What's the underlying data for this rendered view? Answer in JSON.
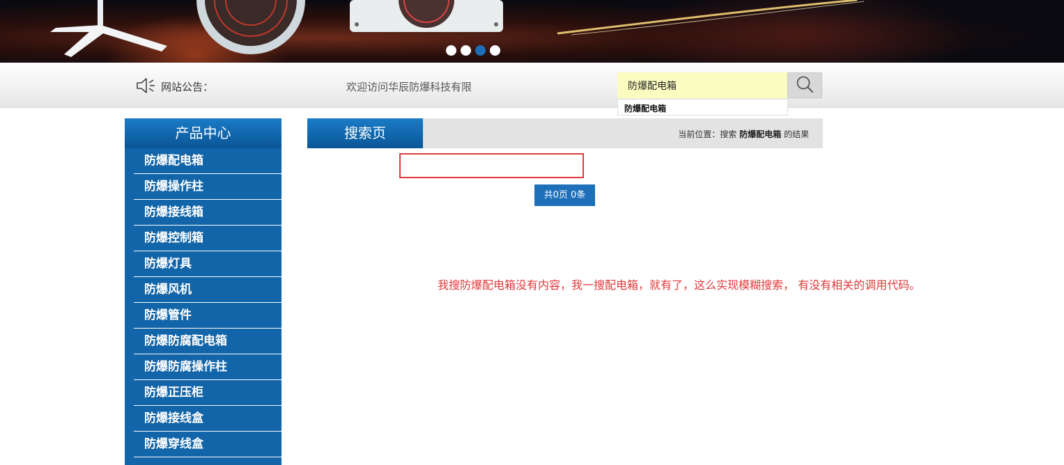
{
  "banner": {
    "slides": [
      {
        "active": false
      },
      {
        "active": false
      },
      {
        "active": true
      },
      {
        "active": false
      }
    ],
    "active_color": "#1c6fb8"
  },
  "notice": {
    "icon": "speaker-icon",
    "label": "网站公告：",
    "text": "欢迎访问华辰防爆科技有限"
  },
  "search": {
    "value": "防爆配电箱",
    "suggestion": "防爆配电箱",
    "button_icon": "search-icon"
  },
  "sidebar": {
    "title": "产品中心",
    "items": [
      {
        "label": "防爆配电箱"
      },
      {
        "label": "防爆操作柱"
      },
      {
        "label": "防爆接线箱"
      },
      {
        "label": "防爆控制箱"
      },
      {
        "label": "防爆灯具"
      },
      {
        "label": "防爆风机"
      },
      {
        "label": "防爆管件"
      },
      {
        "label": "防爆防腐配电箱"
      },
      {
        "label": "防爆防腐操作柱"
      },
      {
        "label": "防爆正压柜"
      },
      {
        "label": "防爆接线盒"
      },
      {
        "label": "防爆穿线盒"
      }
    ]
  },
  "main": {
    "title": "搜索页",
    "breadcrumb": {
      "prefix": "当前位置：搜索",
      "keyword": "防爆配电箱",
      "suffix": "的结果"
    },
    "pager": "共0页 0条",
    "note": "我搜防爆配电箱没有内容，我一搜配电箱，就有了，这么实现模糊搜索，  有没有相关的调用代码。"
  },
  "colors": {
    "primary_blue": "#1265a8",
    "highlight_red": "#e0393b",
    "search_bg": "#fbfdc0"
  }
}
